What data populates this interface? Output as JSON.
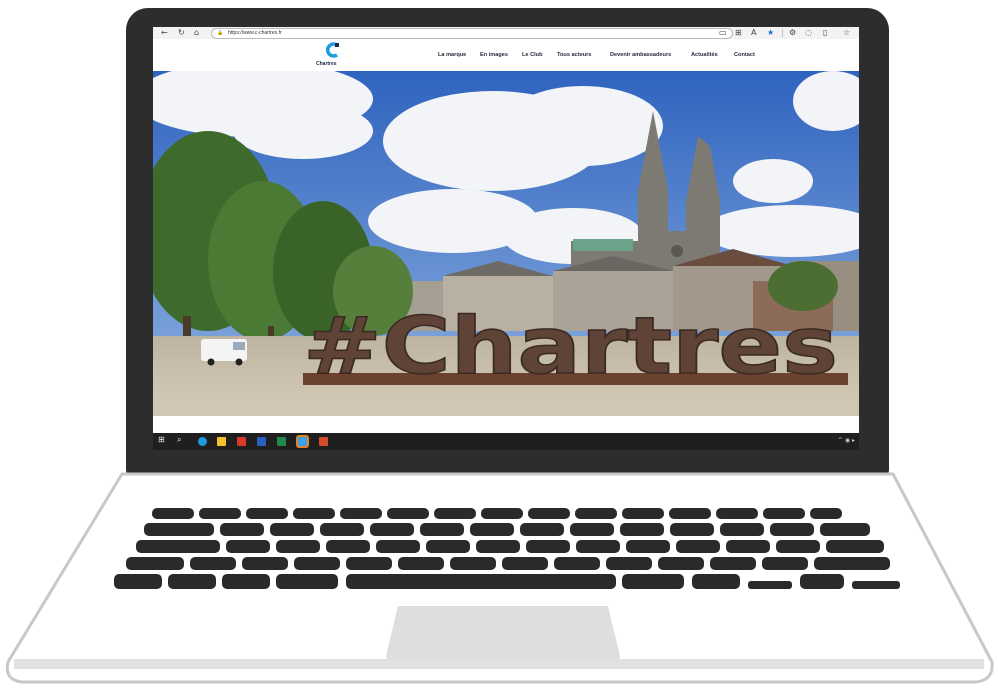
{
  "browser": {
    "url": "https://www.c-chartres.fr",
    "back_icon": "←",
    "refresh_icon": "↻",
    "home_icon": "⌂",
    "lock_icon": "🔒",
    "right_icons": [
      "▭",
      "⊞",
      "A",
      "★",
      "|",
      "⚙",
      "◌",
      "▯",
      "☆"
    ]
  },
  "site": {
    "logo_text": "Chartres",
    "nav": [
      "La marque",
      "En images",
      "Le Club",
      "Tous acteurs",
      "Devenir ambassadeurs",
      "Actualités",
      "Contact"
    ]
  },
  "hero": {
    "sign_text": "#Chartres"
  },
  "taskbar": {
    "start_icon": "⊞",
    "search_icon": "⌕",
    "tray": "^ ◉ ▸"
  },
  "colors": {
    "accent": "#1e9be0",
    "sky": "#3a74c9"
  }
}
